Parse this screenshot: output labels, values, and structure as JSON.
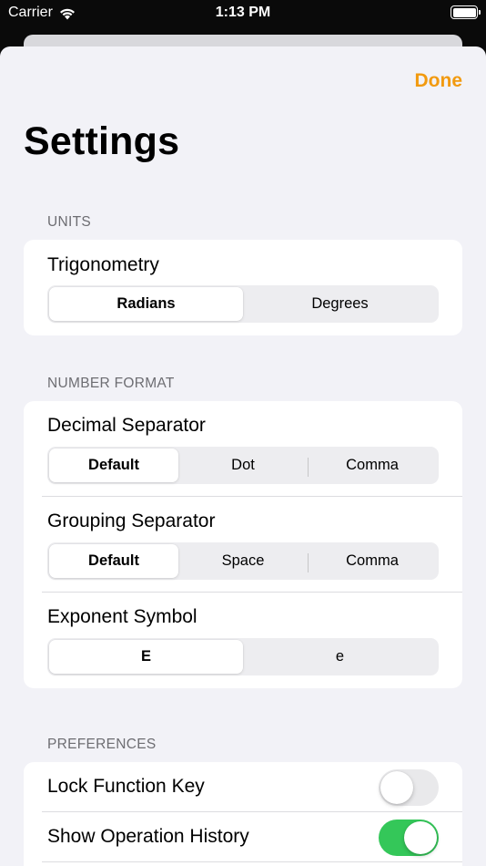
{
  "status_bar": {
    "carrier": "Carrier",
    "time": "1:13 PM"
  },
  "nav": {
    "done_label": "Done"
  },
  "page": {
    "title": "Settings"
  },
  "accent_color": "#f29a0f",
  "units": {
    "header": "UNITS",
    "trigonometry": {
      "label": "Trigonometry",
      "options": [
        "Radians",
        "Degrees"
      ],
      "selected": "Radians"
    }
  },
  "number_format": {
    "header": "NUMBER FORMAT",
    "decimal_separator": {
      "label": "Decimal Separator",
      "options": [
        "Default",
        "Dot",
        "Comma"
      ],
      "selected": "Default"
    },
    "grouping_separator": {
      "label": "Grouping Separator",
      "options": [
        "Default",
        "Space",
        "Comma"
      ],
      "selected": "Default"
    },
    "exponent_symbol": {
      "label": "Exponent Symbol",
      "options": [
        "E",
        "e"
      ],
      "selected": "E"
    }
  },
  "preferences": {
    "header": "PREFERENCES",
    "lock_function_key": {
      "label": "Lock Function Key",
      "on": false
    },
    "show_operation_history": {
      "label": "Show Operation History",
      "on": true
    }
  }
}
